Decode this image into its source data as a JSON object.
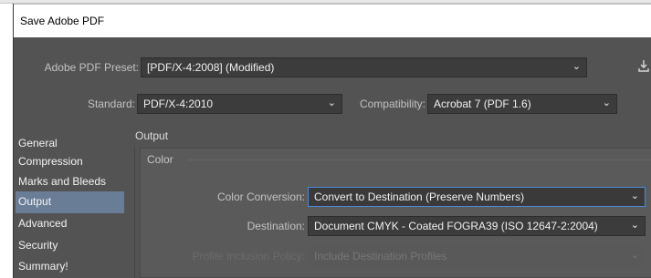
{
  "window": {
    "title": "Save Adobe PDF"
  },
  "preset": {
    "label": "Adobe PDF Preset:",
    "value": "[PDF/X-4:2008] (Modified)"
  },
  "standard": {
    "label": "Standard:",
    "value": "PDF/X-4:2010"
  },
  "compatibility": {
    "label": "Compatibility:",
    "value": "Acrobat 7 (PDF 1.6)"
  },
  "sidebar": {
    "items": [
      {
        "label": "General"
      },
      {
        "label": "Compression"
      },
      {
        "label": "Marks and Bleeds"
      },
      {
        "label": "Output",
        "selected": true
      },
      {
        "label": "Advanced"
      },
      {
        "label": "Security"
      },
      {
        "label": "Summary!"
      }
    ]
  },
  "panel": {
    "title": "Output"
  },
  "color_group": {
    "title": "Color",
    "color_conversion": {
      "label": "Color Conversion:",
      "value": "Convert to Destination (Preserve Numbers)"
    },
    "destination": {
      "label": "Destination:",
      "value": "Document CMYK - Coated FOGRA39 (ISO 12647-2:2004)"
    },
    "profile_inclusion": {
      "label": "Profile Inclusion Policy:",
      "value": "Include Destination Profiles",
      "disabled": true
    }
  },
  "colors": {
    "selection": "#6a7d96",
    "focus_border": "#4b8bd6",
    "dialog_bg": "#535353"
  }
}
